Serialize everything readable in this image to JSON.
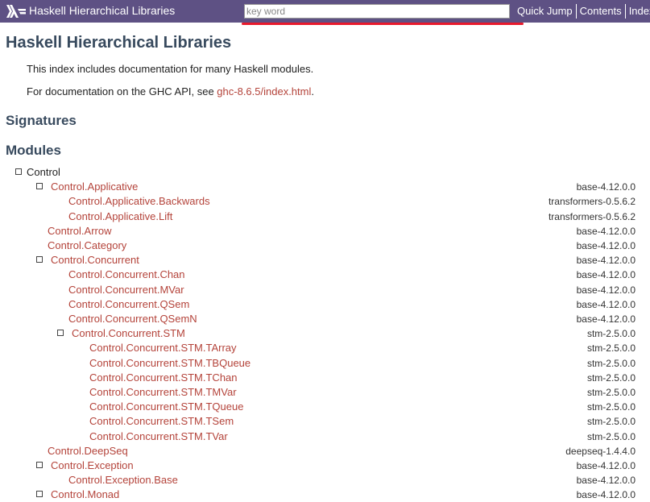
{
  "header": {
    "title": "Haskell Hierarchical Libraries",
    "search_placeholder": "key word",
    "nav": [
      "Quick Jump",
      "Contents",
      "Index"
    ]
  },
  "page": {
    "title": "Haskell Hierarchical Libraries",
    "intro": "This index includes documentation for many Haskell modules.",
    "ghc_api_prefix": "For documentation on the GHC API, see ",
    "ghc_api_link": "ghc-8.6.5/index.html",
    "ghc_api_suffix": ".",
    "signatures_heading": "Signatures",
    "modules_heading": "Modules"
  },
  "modules": [
    {
      "name": "Control",
      "level": 0,
      "collapsible": true,
      "link": false,
      "package": ""
    },
    {
      "name": "Control.Applicative",
      "level": 1,
      "collapsible": true,
      "link": true,
      "package": "base-4.12.0.0"
    },
    {
      "name": "Control.Applicative.Backwards",
      "level": 2,
      "collapsible": false,
      "link": true,
      "package": "transformers-0.5.6.2"
    },
    {
      "name": "Control.Applicative.Lift",
      "level": 2,
      "collapsible": false,
      "link": true,
      "package": "transformers-0.5.6.2"
    },
    {
      "name": "Control.Arrow",
      "level": 1,
      "collapsible": false,
      "link": true,
      "package": "base-4.12.0.0"
    },
    {
      "name": "Control.Category",
      "level": 1,
      "collapsible": false,
      "link": true,
      "package": "base-4.12.0.0"
    },
    {
      "name": "Control.Concurrent",
      "level": 1,
      "collapsible": true,
      "link": true,
      "package": "base-4.12.0.0"
    },
    {
      "name": "Control.Concurrent.Chan",
      "level": 2,
      "collapsible": false,
      "link": true,
      "package": "base-4.12.0.0"
    },
    {
      "name": "Control.Concurrent.MVar",
      "level": 2,
      "collapsible": false,
      "link": true,
      "package": "base-4.12.0.0"
    },
    {
      "name": "Control.Concurrent.QSem",
      "level": 2,
      "collapsible": false,
      "link": true,
      "package": "base-4.12.0.0"
    },
    {
      "name": "Control.Concurrent.QSemN",
      "level": 2,
      "collapsible": false,
      "link": true,
      "package": "base-4.12.0.0"
    },
    {
      "name": "Control.Concurrent.STM",
      "level": 2,
      "collapsible": true,
      "link": true,
      "package": "stm-2.5.0.0"
    },
    {
      "name": "Control.Concurrent.STM.TArray",
      "level": 3,
      "collapsible": false,
      "link": true,
      "package": "stm-2.5.0.0"
    },
    {
      "name": "Control.Concurrent.STM.TBQueue",
      "level": 3,
      "collapsible": false,
      "link": true,
      "package": "stm-2.5.0.0"
    },
    {
      "name": "Control.Concurrent.STM.TChan",
      "level": 3,
      "collapsible": false,
      "link": true,
      "package": "stm-2.5.0.0"
    },
    {
      "name": "Control.Concurrent.STM.TMVar",
      "level": 3,
      "collapsible": false,
      "link": true,
      "package": "stm-2.5.0.0"
    },
    {
      "name": "Control.Concurrent.STM.TQueue",
      "level": 3,
      "collapsible": false,
      "link": true,
      "package": "stm-2.5.0.0"
    },
    {
      "name": "Control.Concurrent.STM.TSem",
      "level": 3,
      "collapsible": false,
      "link": true,
      "package": "stm-2.5.0.0"
    },
    {
      "name": "Control.Concurrent.STM.TVar",
      "level": 3,
      "collapsible": false,
      "link": true,
      "package": "stm-2.5.0.0"
    },
    {
      "name": "Control.DeepSeq",
      "level": 1,
      "collapsible": false,
      "link": true,
      "package": "deepseq-1.4.4.0"
    },
    {
      "name": "Control.Exception",
      "level": 1,
      "collapsible": true,
      "link": true,
      "package": "base-4.12.0.0"
    },
    {
      "name": "Control.Exception.Base",
      "level": 2,
      "collapsible": false,
      "link": true,
      "package": "base-4.12.0.0"
    },
    {
      "name": "Control.Monad",
      "level": 1,
      "collapsible": true,
      "link": true,
      "package": "base-4.12.0.0"
    }
  ],
  "colors": {
    "topbar": "#5e5184",
    "link": "#b4433a",
    "heading": "#384a5e",
    "highlight": "#e8192c"
  }
}
